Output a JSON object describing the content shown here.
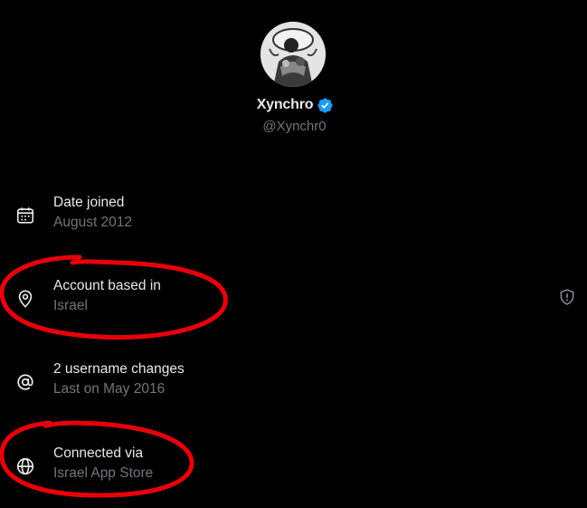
{
  "profile": {
    "display_name": "Xynchro",
    "handle": "@Xynchr0",
    "verified": true,
    "avatar_icon": "profile-avatar-image"
  },
  "rows": [
    {
      "icon": "calendar-icon",
      "title": "Date joined",
      "subtitle": "August 2012"
    },
    {
      "icon": "location-pin-icon",
      "title": "Account based in",
      "subtitle": "Israel"
    },
    {
      "icon": "at-sign-icon",
      "title": "2 username changes",
      "subtitle": "Last on May 2016"
    },
    {
      "icon": "globe-icon",
      "title": "Connected via",
      "subtitle": "Israel App Store"
    }
  ],
  "colors": {
    "background": "#000000",
    "primary_text": "#e7e9ea",
    "secondary_text": "#71767b",
    "verified_blue": "#1d9bf0",
    "annotation_red": "#e8000a"
  },
  "icons": {
    "verified": "verified-badge-icon",
    "privacy": "shield-info-icon"
  }
}
